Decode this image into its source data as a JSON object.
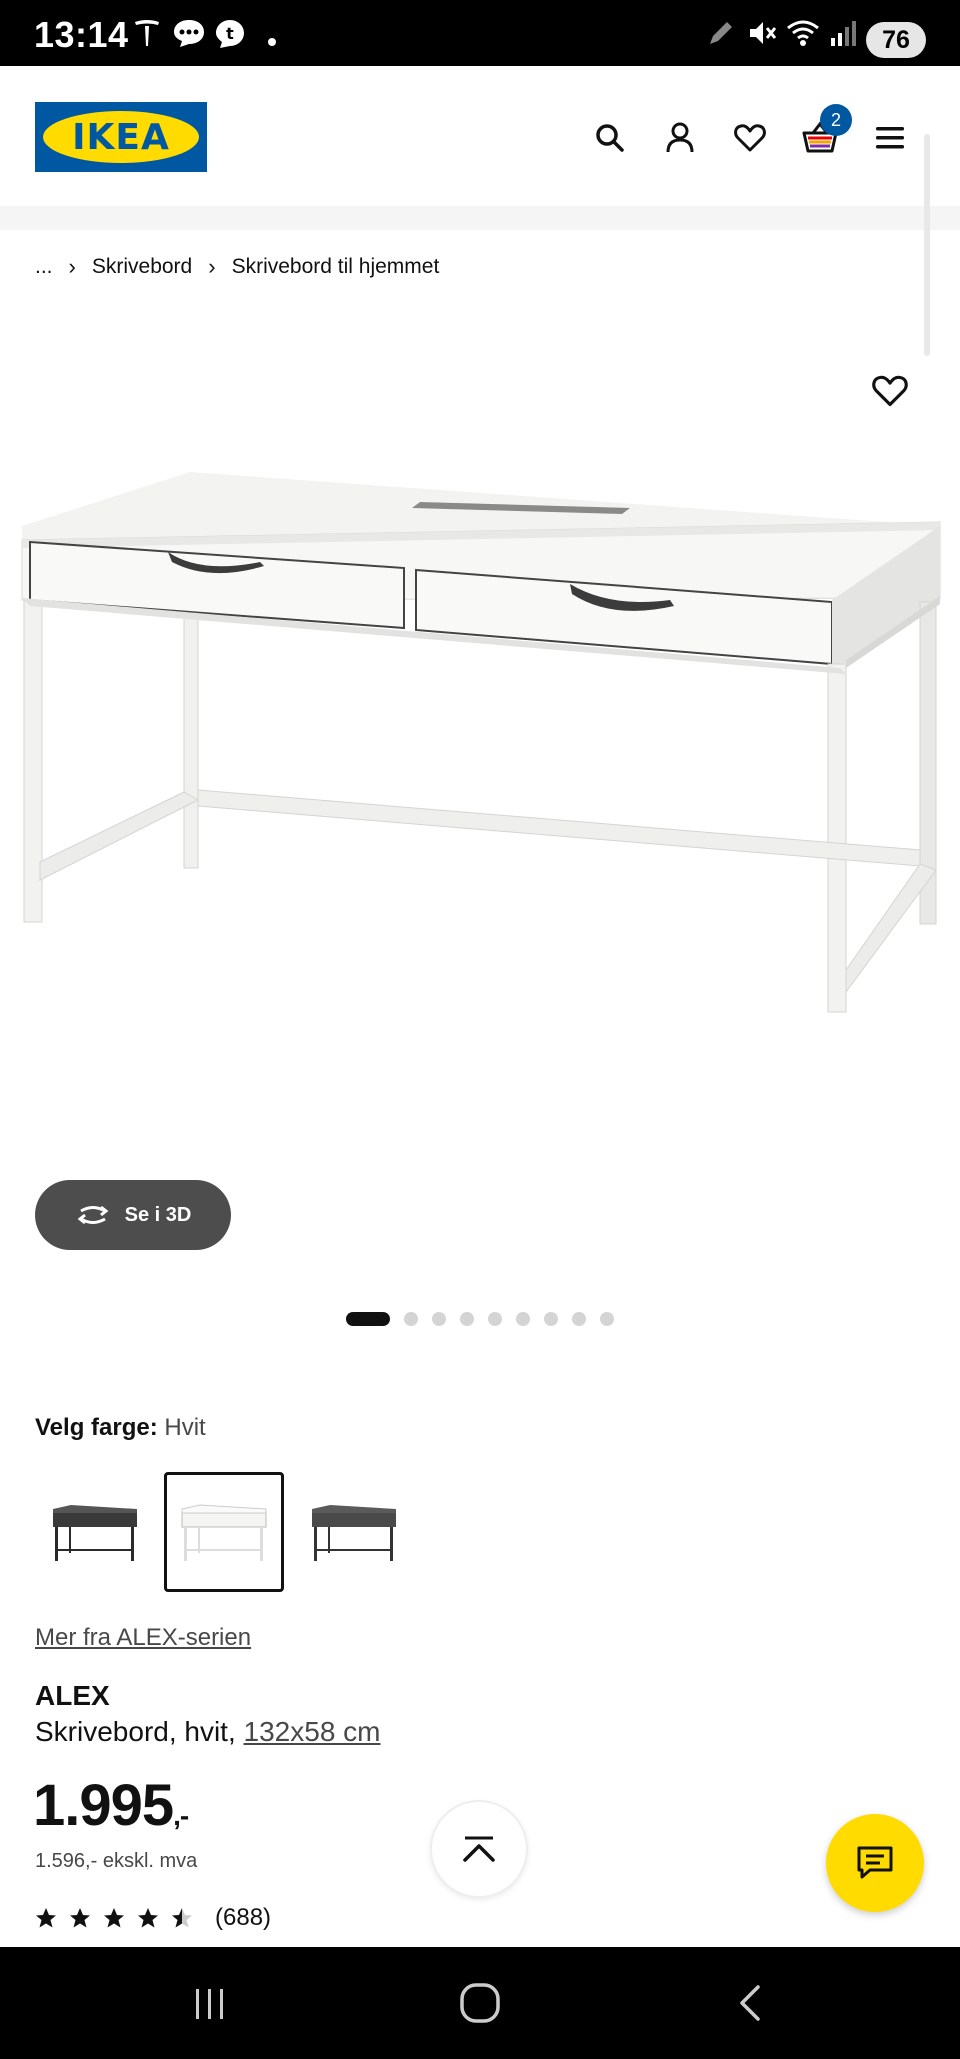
{
  "status_bar": {
    "time": "13:14",
    "battery": "76"
  },
  "header": {
    "logo_text": "IKEA",
    "cart_count": "2"
  },
  "breadcrumb": {
    "ellipsis": "...",
    "items": [
      "Skrivebord",
      "Skrivebord til hjemmet"
    ]
  },
  "gallery": {
    "view_3d_label": "Se i 3D",
    "total_images": 9,
    "active_index": 0
  },
  "color": {
    "label": "Velg farge:",
    "value": "Hvit",
    "options": [
      "black-brown",
      "white",
      "grey-turquoise"
    ],
    "selected_index": 1
  },
  "product": {
    "series_link": "Mer fra ALEX-serien",
    "name": "ALEX",
    "desc_prefix": "Skrivebord, hvit,",
    "size_link": "132x58 cm",
    "price": "1.995",
    "price_suffix": ",-",
    "price_ex_vat": "1.596,- ekskl. mva",
    "rating": 4.5,
    "review_count": "(688)"
  },
  "colors": {
    "ikea_blue": "#0058a3",
    "ikea_yellow": "#ffdb00",
    "dark_button": "#4d4d4d"
  }
}
